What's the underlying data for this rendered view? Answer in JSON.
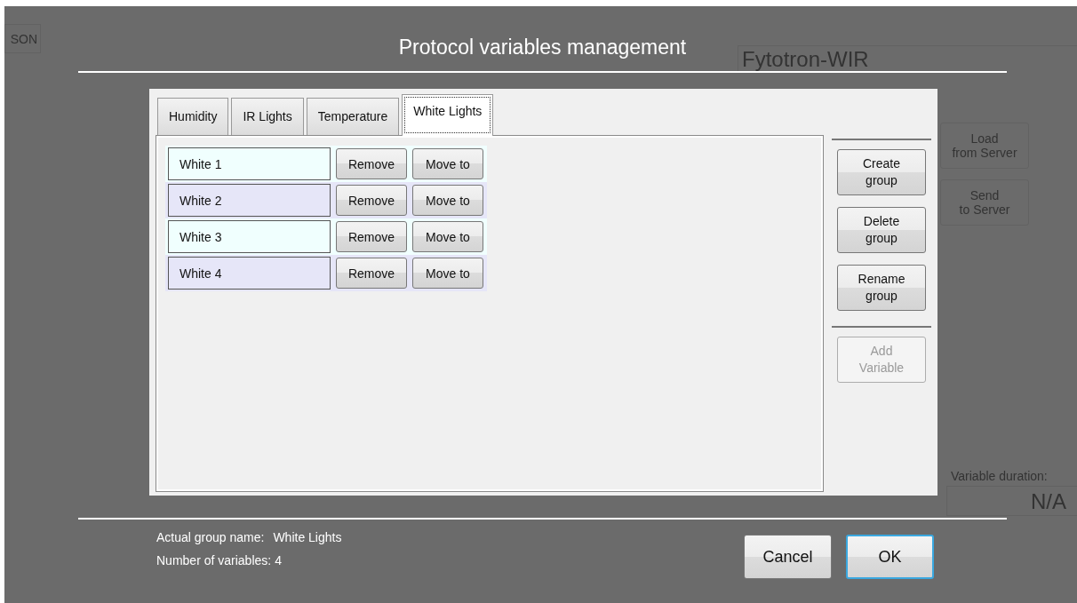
{
  "background_app": {
    "tab_label": "SON",
    "title_field": "Fytotron-WIR",
    "buttons": [
      "Load\nfrom Server",
      "Send\nto Server"
    ],
    "variable_duration": {
      "label": "Variable duration:",
      "value": "N/A"
    }
  },
  "dialog": {
    "title": "Protocol variables management",
    "tabs": [
      {
        "label": "Humidity",
        "selected": false
      },
      {
        "label": "IR Lights",
        "selected": false
      },
      {
        "label": "Temperature",
        "selected": false
      },
      {
        "label": "White Lights",
        "selected": true
      }
    ],
    "variables": [
      {
        "name": "White 1",
        "color": "#f0fffe",
        "remove": "Remove",
        "move": "Move to"
      },
      {
        "name": "White 2",
        "color": "#e6e6f8",
        "remove": "Remove",
        "move": "Move to"
      },
      {
        "name": "White 3",
        "color": "#f0fffe",
        "remove": "Remove",
        "move": "Move to"
      },
      {
        "name": "White 4",
        "color": "#e6e6f8",
        "remove": "Remove",
        "move": "Move to"
      }
    ],
    "group_buttons": [
      {
        "label": "Create\ngroup",
        "disabled": false
      },
      {
        "label": "Delete\ngroup",
        "disabled": false
      },
      {
        "label": "Rename\ngroup",
        "disabled": false
      }
    ],
    "variable_buttons": [
      {
        "label": "Add\nVariable",
        "disabled": true
      }
    ],
    "info": {
      "group_label": "Actual group name:",
      "group_value": "White Lights",
      "count_label": "Number of variables:",
      "count_value": "4"
    },
    "buttons": [
      {
        "label": "Cancel",
        "default": false
      },
      {
        "label": "OK",
        "default": true
      }
    ]
  }
}
